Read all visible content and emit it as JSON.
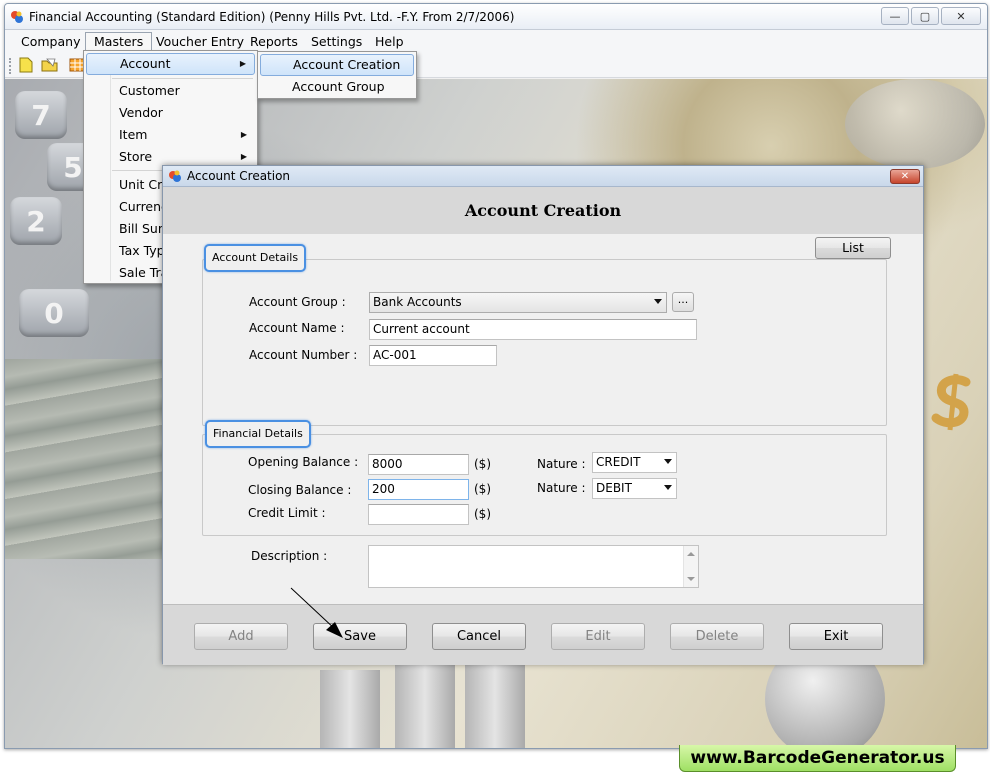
{
  "window": {
    "title": "Financial Accounting (Standard Edition) (Penny Hills Pvt. Ltd. -F.Y. From 2/7/2006)",
    "minimize": "—",
    "maximize": "▢",
    "close": "✕"
  },
  "menubar": [
    "Company",
    "Masters",
    "Voucher Entry",
    "Reports",
    "Settings",
    "Help"
  ],
  "masters_menu": {
    "items": [
      "Account",
      "Customer",
      "Vendor",
      "Item",
      "Store",
      "Unit Cre",
      "Currenc",
      "Bill Sun",
      "Tax Typ",
      "Sale Tra"
    ],
    "submenu_arrow": "▶"
  },
  "account_submenu": [
    "Account Creation",
    "Account Group"
  ],
  "dialog": {
    "title": "Account Creation",
    "close": "✕",
    "heading": "Account Creation",
    "list_button": "List",
    "account_details": {
      "tag": "Account Details",
      "group_label": "Account Group :",
      "group_value": "Bank Accounts",
      "group_browse": "...",
      "name_label": "Account Name :",
      "name_value": "Current account",
      "number_label": "Account Number :",
      "number_value": "AC-001"
    },
    "financial_details": {
      "tag": "Financial Details",
      "opening_label": "Opening Balance :",
      "opening_value": "8000",
      "closing_label": "Closing Balance :",
      "closing_value": "200",
      "credit_label": "Credit Limit :",
      "credit_value": "",
      "unit": "($)",
      "nature_label": "Nature :",
      "nature_opening": "CREDIT",
      "nature_closing": "DEBIT"
    },
    "description_label": "Description :",
    "buttons": [
      "Add",
      "Save",
      "Cancel",
      "Edit",
      "Delete",
      "Exit"
    ]
  },
  "watermark": "www.BarcodeGenerator.us",
  "colors": {
    "focus_border": "#4a90e2",
    "menu_highlight": "#cfe4fa",
    "watermark_green": "#9fe064"
  }
}
